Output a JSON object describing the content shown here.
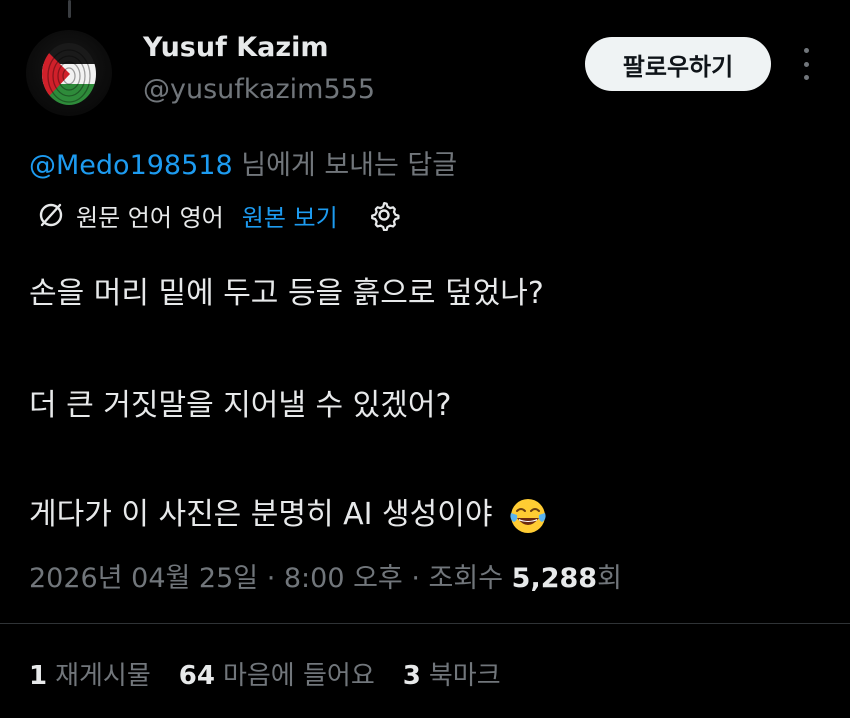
{
  "author": {
    "name": "Yusuf Kazim",
    "handle": "@yusufkazim555",
    "avatar_icon": "palestine-flag-fingerprint-icon"
  },
  "follow_label": "팔로우하기",
  "reply_context": {
    "mention": "@Medo198518",
    "suffix": " 님에게 보내는 답글"
  },
  "translation": {
    "original_language": "원문 언어 영어",
    "show_original": "원본 보기"
  },
  "body": {
    "line1": "손을 머리 밑에 두고 등을 흙으로 덮었나?",
    "line2": "더 큰 거짓말을 지어낼 수 있겠어?",
    "line3": "게다가 이 사진은 분명히 AI 생성이야",
    "emoji": "face-with-tears-of-joy"
  },
  "meta": {
    "date": "2026년 04월 25일",
    "time": "8:00 오후",
    "views_label": "조회수",
    "views_count": "5,288",
    "views_suffix": "회",
    "separator": " · "
  },
  "stats": {
    "reposts_count": "1",
    "reposts_label": "재게시물",
    "likes_count": "64",
    "likes_label": "마음에 들어요",
    "bookmarks_count": "3",
    "bookmarks_label": "북마크"
  },
  "colors": {
    "background": "#000000",
    "text": "#e7e9ea",
    "muted": "#71767b",
    "accent": "#1d9bf0"
  }
}
